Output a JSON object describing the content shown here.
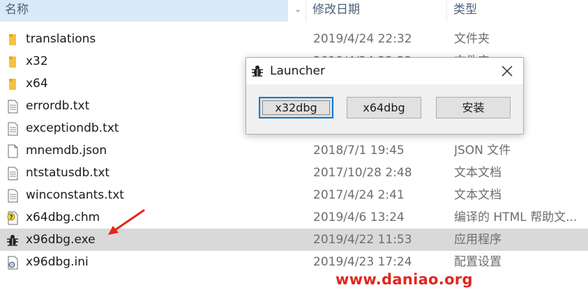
{
  "header": {
    "name": "名称",
    "date": "修改日期",
    "type": "类型"
  },
  "rows": [
    {
      "name": "translations",
      "date": "2019/4/24 22:32",
      "type": "文件夹",
      "icon": "folder-icon"
    },
    {
      "name": "x32",
      "date": "2019/4/24 22:32",
      "type": "文件夹",
      "icon": "folder-icon"
    },
    {
      "name": "x64",
      "date": "",
      "type": "",
      "icon": "folder-icon"
    },
    {
      "name": "errordb.txt",
      "date": "",
      "type": "",
      "icon": "text-file-icon"
    },
    {
      "name": "exceptiondb.txt",
      "date": "",
      "type": "",
      "icon": "text-file-icon"
    },
    {
      "name": "mnemdb.json",
      "date": "2018/7/1 19:45",
      "type": "JSON 文件",
      "icon": "blank-file-icon"
    },
    {
      "name": "ntstatusdb.txt",
      "date": "2017/10/28 2:48",
      "type": "文本文档",
      "icon": "text-file-icon"
    },
    {
      "name": "winconstants.txt",
      "date": "2017/4/24 2:41",
      "type": "文本文档",
      "icon": "text-file-icon"
    },
    {
      "name": "x64dbg.chm",
      "date": "2019/4/6 13:24",
      "type": "编译的 HTML 帮助文...",
      "icon": "help-file-icon"
    },
    {
      "name": "x96dbg.exe",
      "date": "2019/4/22 11:53",
      "type": "应用程序",
      "icon": "bug-icon"
    },
    {
      "name": "x96dbg.ini",
      "date": "2019/4/23 17:24",
      "type": "配置设置",
      "icon": "settings-file-icon"
    }
  ],
  "dialog": {
    "title": "Launcher",
    "buttons": [
      "x32dbg",
      "x64dbg",
      "安装"
    ]
  },
  "watermark": "www.daniao.org",
  "colors": {
    "header_selected": "#d9ebf9",
    "row_selected": "#d9d9d9",
    "folder": "#f5c242",
    "accent_arrow": "#e1261c",
    "watermark": "#e1261c"
  }
}
